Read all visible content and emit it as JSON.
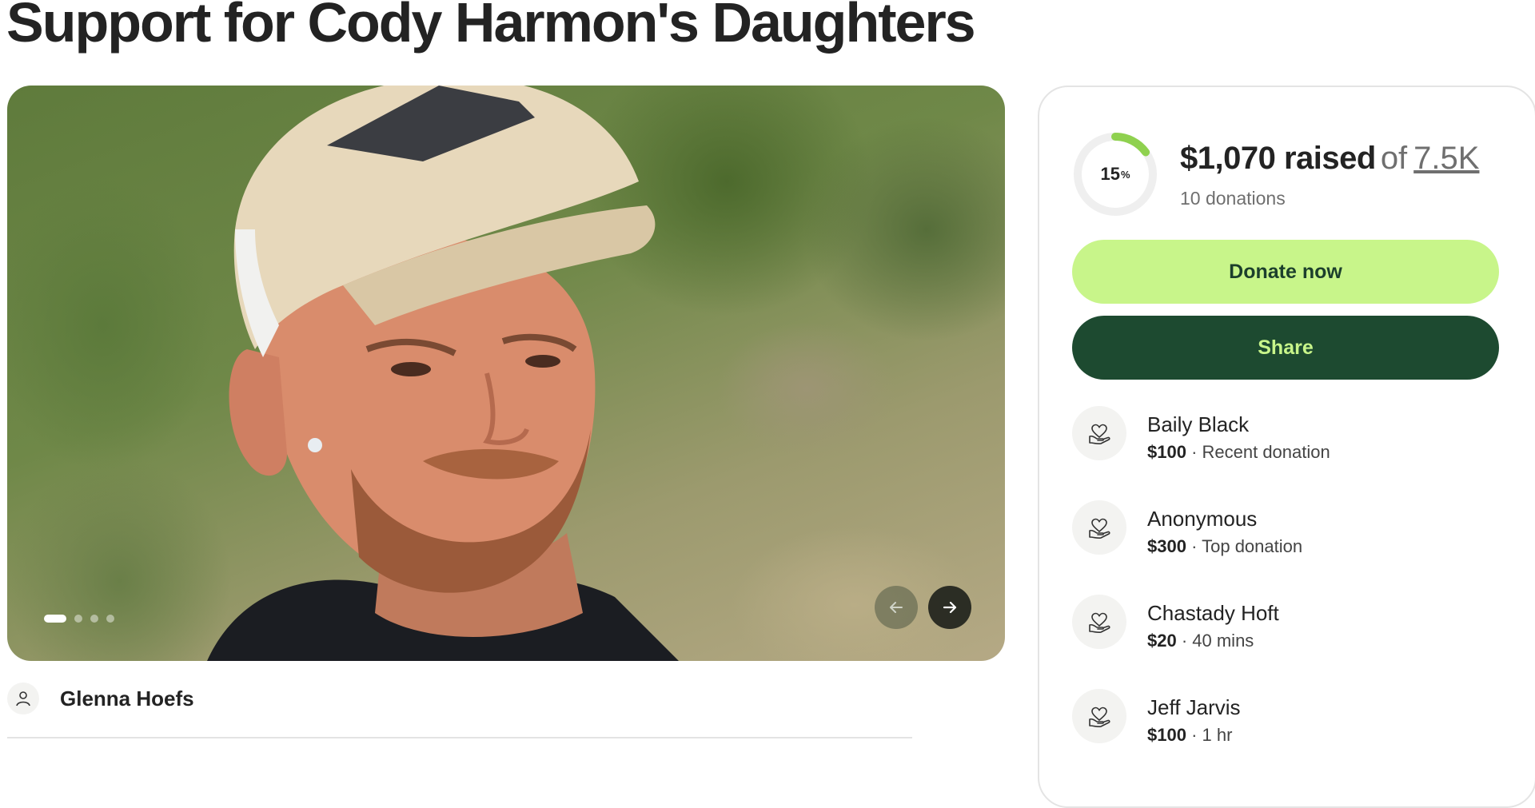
{
  "page": {
    "title": "Support for Cody Harmon's Daughters"
  },
  "gallery": {
    "slide_count": 4,
    "active_slide": 1
  },
  "organizer": {
    "name": "Glenna Hoefs"
  },
  "progress": {
    "percent_value": "15",
    "percent_sign": "%",
    "percent_fraction": 0.15,
    "raised": "$1,070 raised",
    "of_label": "of",
    "goal": "7.5K",
    "donations": "10 donations"
  },
  "buttons": {
    "donate": "Donate now",
    "share": "Share"
  },
  "donors": [
    {
      "name": "Baily Black",
      "amount": "$100",
      "detail": " · Recent donation"
    },
    {
      "name": "Anonymous",
      "amount": "$300",
      "detail": " · Top donation"
    },
    {
      "name": "Chastady Hoft",
      "amount": "$20",
      "detail": " · 40 mins"
    },
    {
      "name": "Jeff Jarvis",
      "amount": "$100",
      "detail": " · 1 hr"
    }
  ],
  "colors": {
    "accent_green": "#c8f58a",
    "dark_green": "#1d4a30",
    "progress_green": "#8fd14f",
    "text": "#232323"
  }
}
